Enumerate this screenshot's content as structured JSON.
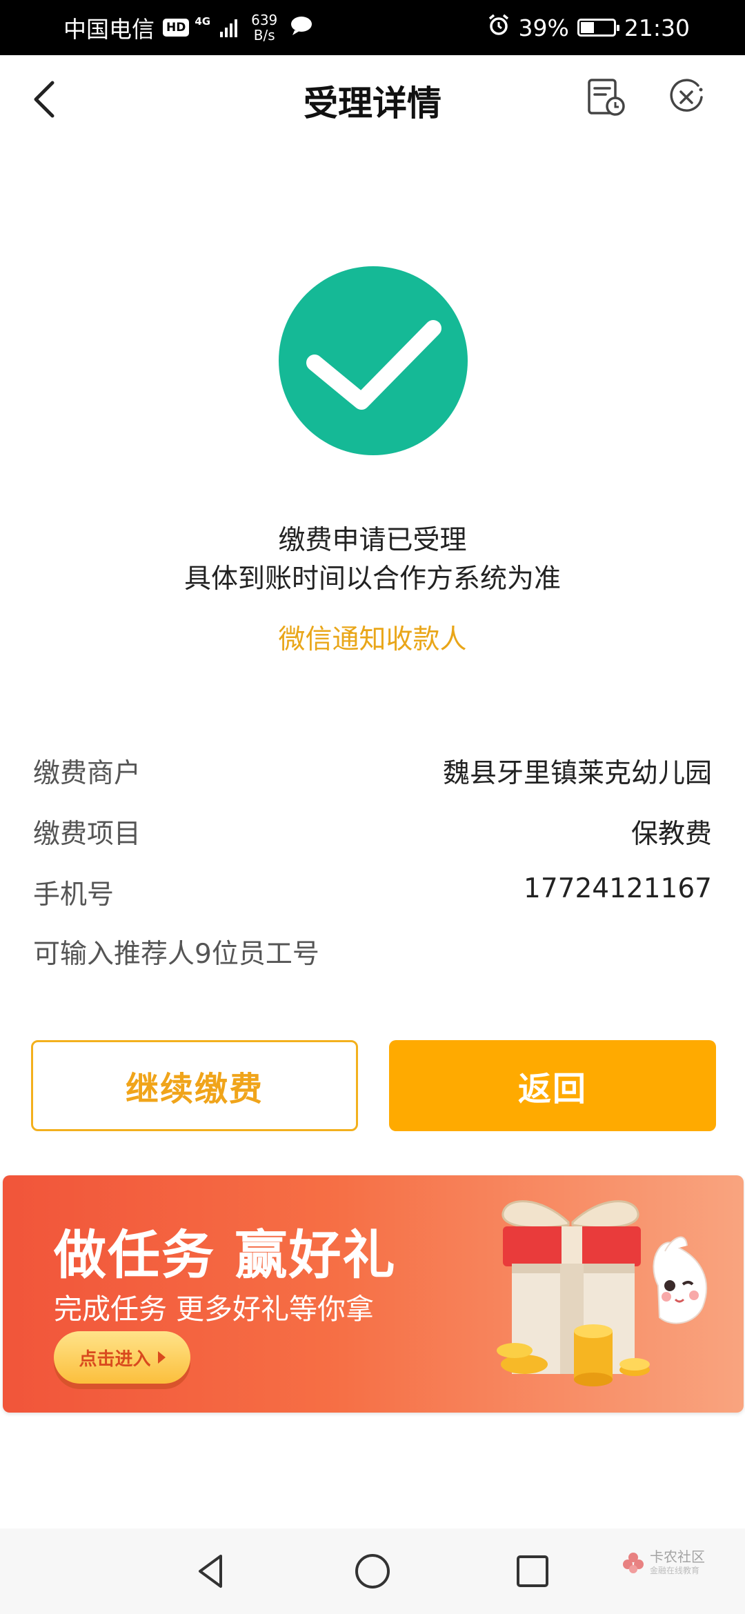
{
  "status_bar": {
    "carrier": "中国电信",
    "hd": "HD",
    "network": "4G",
    "speed_value": "639",
    "speed_unit": "B/s",
    "battery": "39%",
    "time": "21:30"
  },
  "header": {
    "title": "受理详情",
    "icons": [
      "back-arrow-icon",
      "document-clock-icon",
      "close-circle-icon"
    ]
  },
  "result": {
    "line1": "缴费申请已受理",
    "line2": "具体到账时间以合作方系统为准",
    "notify_link": "微信通知收款人",
    "accent_color": "#15b996",
    "link_color": "#e9a619"
  },
  "details": [
    {
      "label": "缴费商户",
      "value": "魏县牙里镇莱克幼儿园"
    },
    {
      "label": "缴费项目",
      "value": "保教费"
    },
    {
      "label": "手机号",
      "value": "17724121167"
    },
    {
      "label": "可输入推荐人9位员工号",
      "value": ""
    }
  ],
  "buttons": {
    "continue_label": "继续缴费",
    "return_label": "返回",
    "brand_color": "#ffaa00"
  },
  "banner": {
    "title": "做任务 赢好礼",
    "subtitle": "完成任务 更多好礼等你拿",
    "cta": "点击进入"
  },
  "nav_bar": {
    "icons": [
      "nav-back-icon",
      "nav-home-icon",
      "nav-recents-icon"
    ],
    "watermark_title": "卡农社区",
    "watermark_sub": "金融在线教育"
  }
}
